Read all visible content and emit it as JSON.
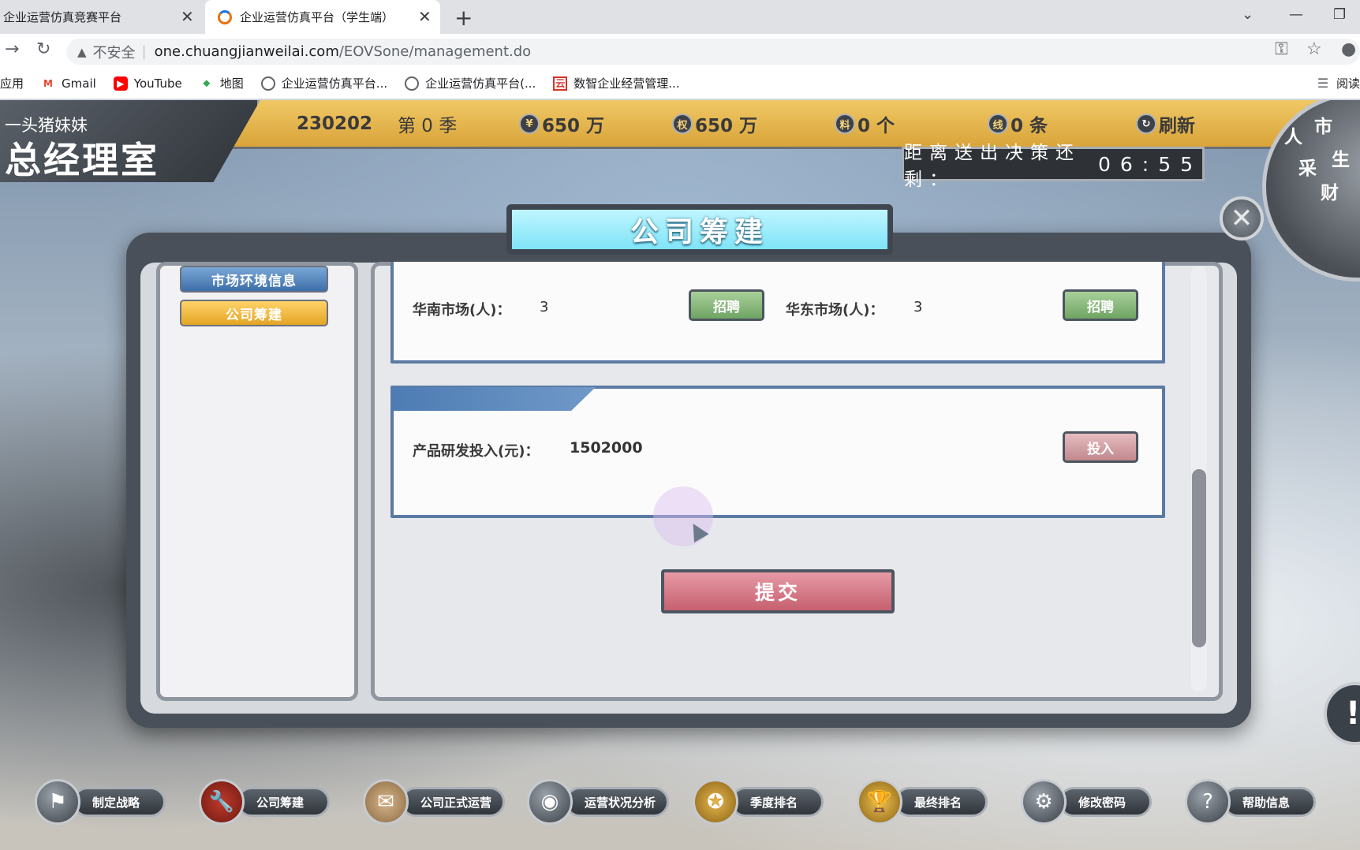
{
  "browser": {
    "tabs": [
      {
        "title": "企业运营仿真竞赛平台"
      },
      {
        "title": "企业运营仿真平台（学生端）"
      }
    ],
    "address": {
      "security_label": "不安全",
      "url_host": "one.chuangjianweilai.com",
      "url_path": "/EOVSone/management.do"
    },
    "bookmarks": [
      {
        "label": "应用",
        "icon": "apps-icon"
      },
      {
        "label": "Gmail",
        "icon": "gmail-icon"
      },
      {
        "label": "YouTube",
        "icon": "youtube-icon"
      },
      {
        "label": "地图",
        "icon": "maps-icon"
      },
      {
        "label": "企业运营仿真平台...",
        "icon": "globe-icon"
      },
      {
        "label": "企业运营仿真平台(...",
        "icon": "globe-icon"
      },
      {
        "label": "数智企业经营管理...",
        "icon": "site-icon"
      }
    ],
    "reading_list": "阅读"
  },
  "header": {
    "user_name": "一头猪妹妹",
    "office_title": "总经理室",
    "company_code": "230202",
    "season": "第 0 季",
    "cash": "650 万",
    "equity": "650 万",
    "materials": "0 个",
    "lines": "0 条",
    "refresh_label": "刷新",
    "badges": {
      "cash": "¥",
      "equity": "权",
      "materials": "料",
      "lines": "线"
    },
    "countdown_label": "距离送出决策还剩：",
    "countdown_time": "06:55",
    "wheel_items": [
      "市",
      "人",
      "生",
      "采",
      "财"
    ]
  },
  "dialog": {
    "title": "公司筹建",
    "sidebar": [
      "市场环境信息",
      "公司筹建"
    ],
    "recruit": {
      "south_label": "华南市场(人)：",
      "south_value": "3",
      "east_label": "华东市场(人)：",
      "east_value": "3",
      "button": "招聘"
    },
    "rd": {
      "label": "产品研发投入(元)：",
      "value": "1502000",
      "button": "投入"
    },
    "submit": "提交"
  },
  "bottom_nav": [
    {
      "label": "制定战略",
      "icon": "flag-icon"
    },
    {
      "label": "公司筹建",
      "icon": "wrench-icon"
    },
    {
      "label": "公司正式运营",
      "icon": "scroll-icon"
    },
    {
      "label": "运营状况分析",
      "icon": "gauge-icon"
    },
    {
      "label": "季度排名",
      "icon": "medal-icon"
    },
    {
      "label": "最终排名",
      "icon": "trophy-icon"
    },
    {
      "label": "修改密码",
      "icon": "gear-icon"
    },
    {
      "label": "帮助信息",
      "icon": "help-icon"
    }
  ],
  "colors": {
    "header_gold": "#e4b24d",
    "card_border": "#5b7aa4",
    "submit_red": "#c6606f",
    "title_cyan": "#9ff0ff"
  }
}
